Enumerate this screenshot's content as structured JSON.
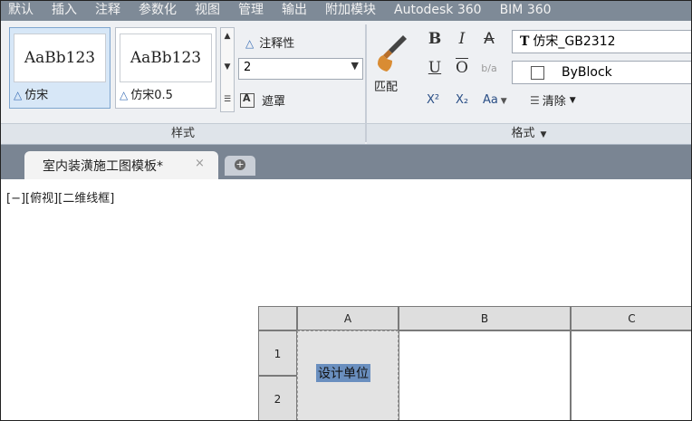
{
  "ribbon_tabs": [
    "默认",
    "插入",
    "注释",
    "参数化",
    "视图",
    "管理",
    "输出",
    "附加模块",
    "Autodesk 360",
    "BIM 360"
  ],
  "style_panel": {
    "swatches": [
      {
        "sample": "AaBb123",
        "name": "仿宋",
        "selected": true
      },
      {
        "sample": "AaBb123",
        "name": "仿宋0.5",
        "selected": false
      }
    ],
    "annotative_label": "注释性",
    "height_value": "2",
    "mask_label": "遮罩",
    "title": "样式"
  },
  "format_panel": {
    "match_label": "匹配",
    "bold": "B",
    "italic": "I",
    "strike": "A",
    "underline": "U",
    "overline": "O",
    "stack": "b/a",
    "superscript": "X²",
    "subscript": "X₂",
    "case": "Aa",
    "font_value": "仿宋_GB2312",
    "font_icon": "T",
    "color_value": "ByBlock",
    "clear_label": "清除",
    "title": "格式"
  },
  "document_tab": {
    "title": "室内装潢施工图模板*",
    "close": "×"
  },
  "viewport_label": "[−][俯视][二维线框]",
  "table": {
    "columns": [
      "A",
      "B",
      "C"
    ],
    "rows": [
      "1",
      "2"
    ],
    "merged_cell_text": "设计单位"
  },
  "colors": {
    "ribbon_tab_bg": "#7e8a97",
    "ribbon_bg": "#eef0f3",
    "doc_strip_bg": "#7a8593",
    "selection": "#6a8fbf"
  }
}
